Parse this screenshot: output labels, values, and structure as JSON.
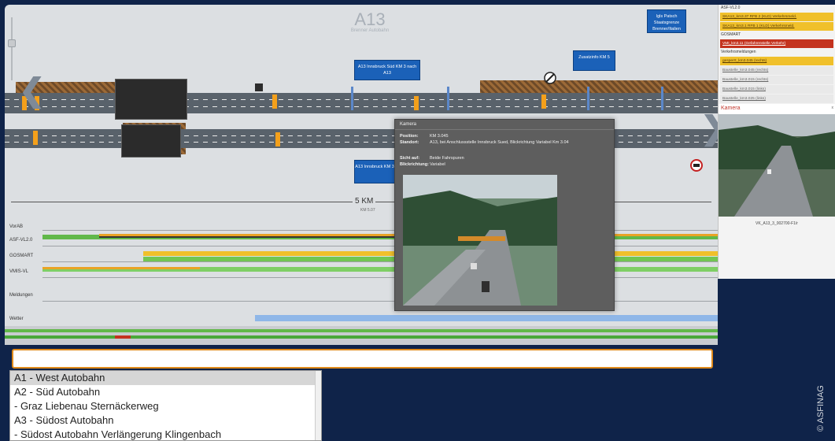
{
  "road": {
    "title": "A13",
    "subtitle": "Brenner Autobahn"
  },
  "boxes": [
    {
      "id": "top-right",
      "text": "Igls Patsch Staatsgrenze Brenner/Italien"
    },
    {
      "id": "center",
      "text": "A13 Innsbruck Süd KM 3 nach A13"
    },
    {
      "id": "right",
      "text": "Zusatzinfo KM 5"
    },
    {
      "id": "lower",
      "text": "A13 Innsbruck KM 3"
    }
  ],
  "distance": {
    "label": "5 KM",
    "sub": "KM 5.07"
  },
  "timeline_labels": [
    "VorAB",
    "ASF-VL2.0",
    "GOSMART",
    "VMIS-VL",
    "Meldungen",
    "Wetter"
  ],
  "camera_popup": {
    "title": "Kamera",
    "rows": [
      {
        "key": "Position:",
        "value": "KM 3.045"
      },
      {
        "key": "Standort:",
        "value": "A13, bei Anschlussstelle Innsbruck Sued, Blickrichtung Variabel Km 3.04"
      },
      {
        "key": "Sicht auf:",
        "value": "Beide Fahrspuren"
      },
      {
        "key": "Blickrichtung:",
        "value": "Variabel"
      }
    ]
  },
  "side_panel": {
    "head1": "ASF-VL2.0",
    "items1": [
      "SKA13_km3.37 RFB 2 (KLD) Verkehrsmeld.",
      "SKA13_km3.1 RFB 1 (KLD) Verkehrsmeld."
    ],
    "head2": "GOSMART",
    "items2": [
      "VMI_km3.11 (Gefahrenstelle Verkehr)"
    ],
    "head3": "Verkehrsmeldungen",
    "items3": [
      "gesperrt_km3.045 (rechts)",
      "Baustelle_km3.045 (rechts)",
      "Baustelle_km3.015 (rechts)",
      "Baustelle_km3.015 (links)",
      "Baustelle_km3.025 (links)"
    ],
    "camera_header": "Kamera",
    "camera_close": "x",
    "camera_caption": "VK_A13_3_002700-F1/r"
  },
  "search": {
    "placeholder": ""
  },
  "road_list": [
    {
      "label": "A1 - West Autobahn",
      "selected": true
    },
    {
      "label": "A2 - Süd Autobahn",
      "selected": false
    },
    {
      "label": "- Graz Liebenau Sternäckerweg",
      "selected": false
    },
    {
      "label": "A3 - Südost Autobahn",
      "selected": false
    },
    {
      "label": "- Südost Autobahn Verlängerung Klingenbach",
      "selected": false
    }
  ],
  "credit": "© ASFINAG"
}
